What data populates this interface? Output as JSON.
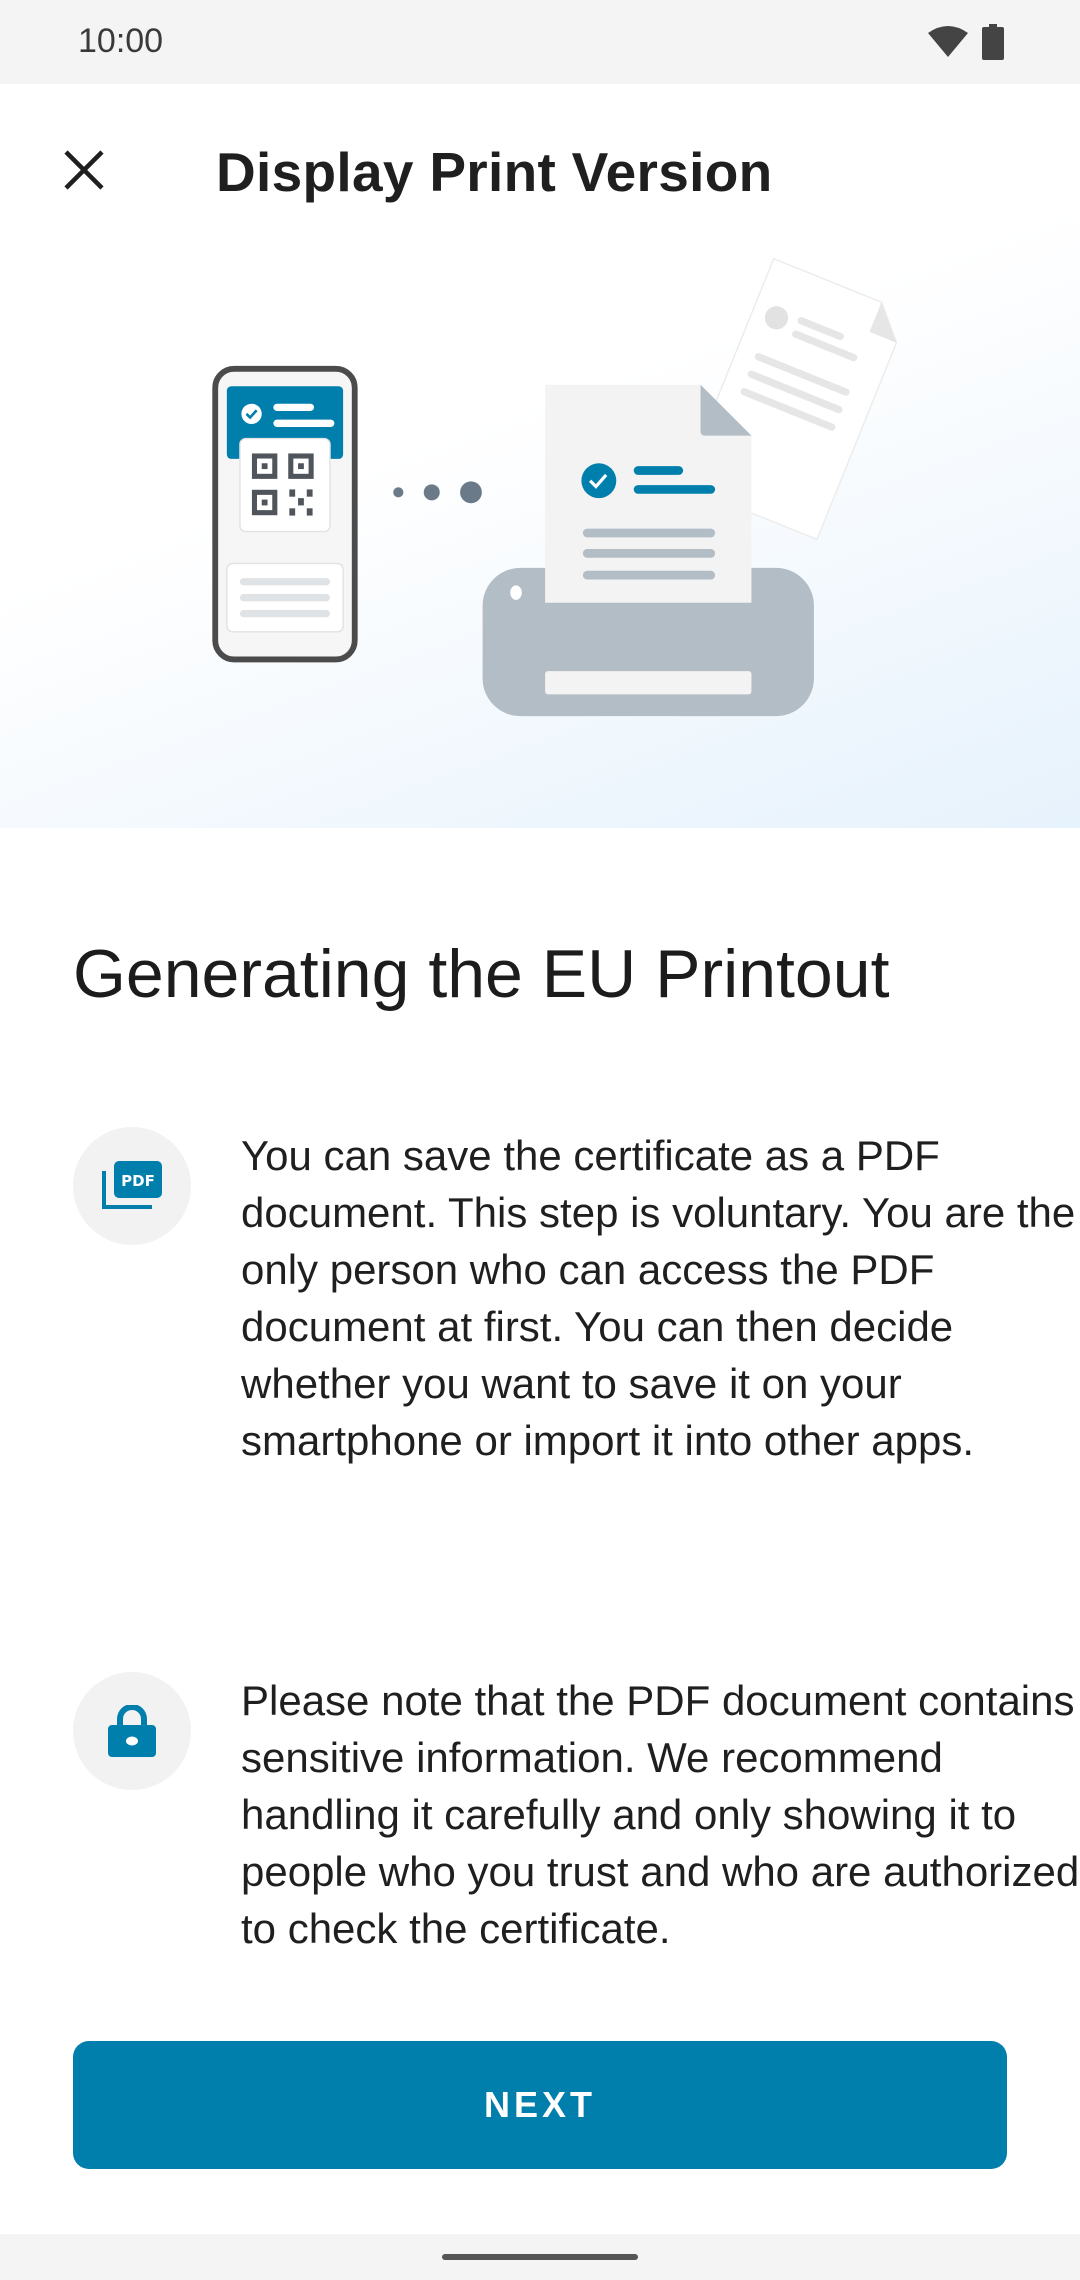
{
  "status_bar": {
    "time": "10:00",
    "icons": [
      "wifi-icon",
      "battery-icon"
    ]
  },
  "app_bar": {
    "title": "Display Print Version",
    "close_icon": "close-icon"
  },
  "colors": {
    "accent": "#007fad",
    "printer_gray": "#b3bdc6",
    "icon_badge_bg": "#f2f2f2"
  },
  "main": {
    "heading": "Generating the EU Printout",
    "items": [
      {
        "icon": "pdf-icon",
        "text": "You can save the certificate as a PDF document. This step is voluntary. You are the only person who can access the PDF document at first. You can then decide whether you want to save it on your smartphone or import it into other apps."
      },
      {
        "icon": "lock-icon",
        "text": "Please note that the PDF document contains sensitive information. We recommend handling it carefully and only showing it to people who you trust and who are authorized to check the certificate."
      }
    ]
  },
  "button": {
    "label": "NEXT"
  }
}
